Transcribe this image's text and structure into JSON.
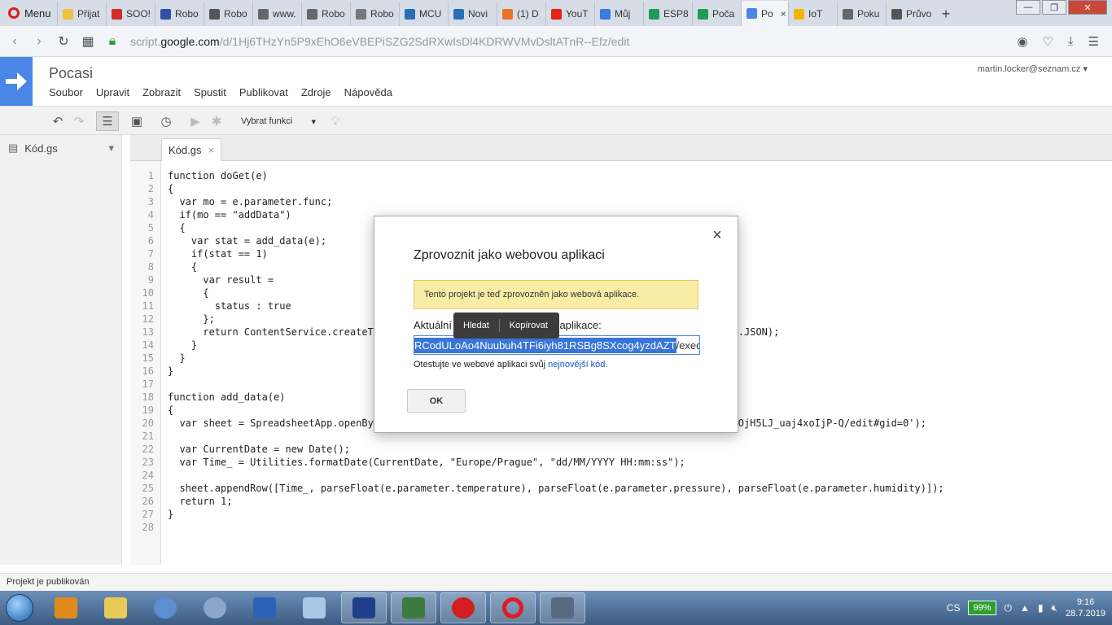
{
  "browser": {
    "menu_label": "Menu",
    "tabs": [
      {
        "label": "Přijat",
        "color": "#f0c040"
      },
      {
        "label": "SOO!",
        "color": "#d12b2b"
      },
      {
        "label": "Robo",
        "color": "#3050a0"
      },
      {
        "label": "Robo",
        "color": "#555555"
      },
      {
        "label": "www.",
        "color": "#666666"
      },
      {
        "label": "Robo",
        "color": "#666666"
      },
      {
        "label": "Robo",
        "color": "#777777"
      },
      {
        "label": "MCU",
        "color": "#2a6fb5"
      },
      {
        "label": "Novi",
        "color": "#2a6fb5"
      },
      {
        "label": "(1) D",
        "color": "#e8732a"
      },
      {
        "label": "YouT",
        "color": "#e62117"
      },
      {
        "label": "Můj",
        "color": "#3a7be0"
      },
      {
        "label": "ESP8",
        "color": "#1e9b57"
      },
      {
        "label": "Poča",
        "color": "#1e9b57"
      },
      {
        "label": "Po",
        "color": "#4a86e8",
        "active": true
      },
      {
        "label": "IoT",
        "color": "#f4b400"
      },
      {
        "label": "Poku",
        "color": "#666666"
      },
      {
        "label": "Průvo",
        "color": "#555555"
      }
    ],
    "url_prefix": "script.",
    "url_domain": "google.com",
    "url_path": "/d/1Hj6THzYn5P9xEhO6eVBEPiSZG2SdRXwIsDl4KDRWVMvDsltATnR--Efz/edit"
  },
  "app": {
    "project_title": "Pocasi",
    "user_email": "martin.locker@seznam.cz",
    "menu": [
      "Soubor",
      "Upravit",
      "Zobrazit",
      "Spustit",
      "Publikovat",
      "Zdroje",
      "Nápověda"
    ],
    "function_select": "Vybrat funkci",
    "file_name": "Kód.gs",
    "editor_tab": "Kód.gs",
    "status_text": "Projekt je publikován"
  },
  "code_lines": [
    "function doGet(e)",
    "{",
    "  var mo = e.parameter.func;",
    "  if(mo == \"addData\")",
    "  {",
    "    var stat = add_data(e);",
    "    if(stat == 1)",
    "    {",
    "      var result =",
    "      {",
    "        status : true",
    "      };",
    "      return ContentService.createT                                                       imeType.JSON);",
    "    }",
    "  }",
    "}",
    "",
    "function add_data(e)",
    "{",
    "  var sheet = SpreadsheetApp.openBy                                                      yCDztpF1OjH5LJ_uaj4xoIjP-Q/edit#gid=0');",
    "",
    "  var CurrentDate = new Date();",
    "  var Time_ = Utilities.formatDate(CurrentDate, \"Europe/Prague\", \"dd/MM/YYYY HH:mm:ss\");",
    "",
    "  sheet.appendRow([Time_, parseFloat(e.parameter.temperature), parseFloat(e.parameter.pressure), parseFloat(e.parameter.humidity)]);",
    "  return 1;",
    "}",
    ""
  ],
  "dialog": {
    "title": "Zprovoznit jako webovou aplikaci",
    "banner": "Tento projekt je teď zprovozněn jako webová aplikace.",
    "label": "Aktuální webové aplikace URL aplikace:",
    "url_selected": "RCodULoAo4Nuubuh4TFi6iyh81RSBg8SXcog4yzdAZT",
    "url_tail": "/exec",
    "hint_prefix": "Otestujte ve webové aplikaci svůj ",
    "hint_link": "nejnovější kód.",
    "ok_label": "OK",
    "close_glyph": "×"
  },
  "context_menu": {
    "find": "Hledat",
    "copy": "Kopírovat"
  },
  "taskbar": {
    "battery": "99%",
    "lang": "CS",
    "time": "9:16",
    "date": "28.7.2019"
  }
}
